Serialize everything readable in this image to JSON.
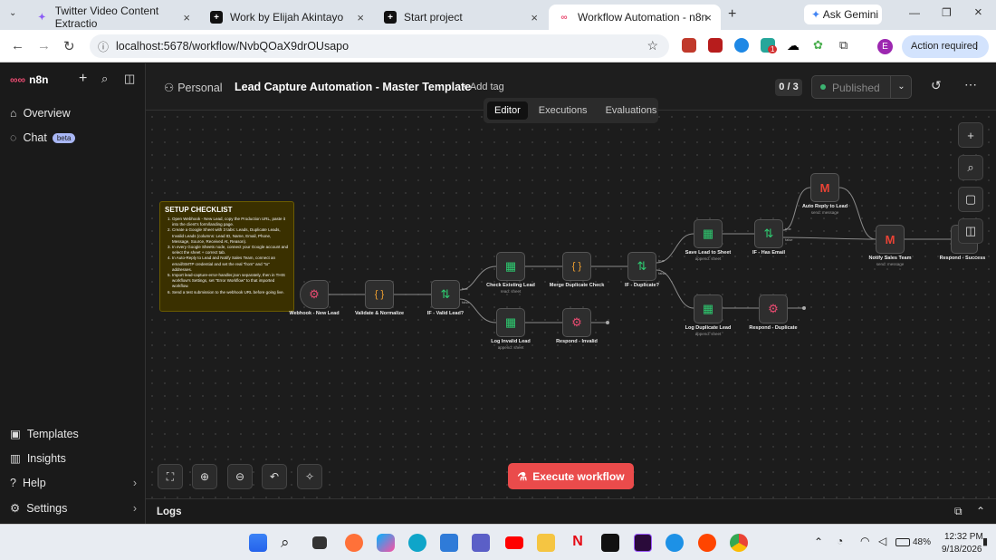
{
  "browser": {
    "tabs": [
      {
        "title": "Twitter Video Content Extractio",
        "icon_color": "#8b5cf6"
      },
      {
        "title": "Work by Elijah Akintayo",
        "icon_color": "#111111"
      },
      {
        "title": "Start project",
        "icon_color": "#111111"
      },
      {
        "title": "Workflow Automation - n8n",
        "icon_color": "#ea4b71"
      }
    ],
    "ask_gemini": "Ask Gemini",
    "url": "localhost:5678/workflow/NvbQOaX9drOUsapo",
    "action_required": "Action required",
    "profile_initial": "E",
    "ext_badge": "1"
  },
  "sidebar": {
    "logo": "n8n",
    "top_items": [
      {
        "label": "Overview",
        "icon": "home-icon"
      },
      {
        "label": "Chat",
        "icon": "chat-icon",
        "badge": "beta"
      }
    ],
    "bottom_items": [
      {
        "label": "Templates",
        "icon": "templates-icon"
      },
      {
        "label": "Insights",
        "icon": "insights-icon"
      },
      {
        "label": "Help",
        "icon": "help-icon"
      },
      {
        "label": "Settings",
        "icon": "settings-icon"
      }
    ]
  },
  "header": {
    "project": "Personal",
    "workflow_title": "Lead Capture Automation - Master Template",
    "add_tag": "+ Add tag",
    "counter": "0 / 3",
    "published": "Published"
  },
  "view_tabs": [
    "Editor",
    "Executions",
    "Evaluations"
  ],
  "note": {
    "title": "SETUP CHECKLIST",
    "items": [
      "Open Webhook - New Lead, copy the Production URL, paste it into the client's form/landing page.",
      "Create a Google Sheet with 3 tabs: Leads, Duplicate Leads, Invalid Leads (columns: Lead ID, Name, Email, Phone, Message, Source, Received At, Reason).",
      "In every Google Sheets node, connect your Google account and select the sheet + correct tab.",
      "In Auto-Reply to Lead and Notify Sales Team, connect an email/SMTP credential and set the real \"from\" and \"to\" addresses.",
      "Import lead-capture-error-handler.json separately, then in THIS workflow's Settings, set \"Error Workflow\" to that imported workflow.",
      "Send a test submission to the webhook URL before going live."
    ]
  },
  "nodes": [
    {
      "label": "Webhook - New Lead",
      "sub": "",
      "glyph": "⚙",
      "color": "#ea4b71"
    },
    {
      "label": "Validate & Normalize",
      "sub": "",
      "glyph": "{ }",
      "color": "#f0a030"
    },
    {
      "label": "IF - Valid Lead?",
      "sub": "",
      "glyph": "⇅",
      "color": "#2ecc71"
    },
    {
      "label": "Check Existing Lead",
      "sub": "read: sheet",
      "glyph": "▦",
      "color": "#2ecc71"
    },
    {
      "label": "Merge Duplicate Check",
      "sub": "",
      "glyph": "{ }",
      "color": "#f0a030"
    },
    {
      "label": "IF - Duplicate?",
      "sub": "",
      "glyph": "⇅",
      "color": "#2ecc71"
    },
    {
      "label": "Log Invalid Lead",
      "sub": "append: sheet",
      "glyph": "▦",
      "color": "#2ecc71"
    },
    {
      "label": "Respond - Invalid",
      "sub": "",
      "glyph": "⚙",
      "color": "#ea4b71"
    },
    {
      "label": "Save Lead to Sheet",
      "sub": "append: sheet",
      "glyph": "▦",
      "color": "#2ecc71"
    },
    {
      "label": "IF - Has Email",
      "sub": "",
      "glyph": "⇅",
      "color": "#2ecc71"
    },
    {
      "label": "Auto Reply to Lead",
      "sub": "send: message",
      "glyph": "M",
      "color": "#ea4335"
    },
    {
      "label": "Notify Sales Team",
      "sub": "send: message",
      "glyph": "M",
      "color": "#ea4335"
    },
    {
      "label": "Respond - Success",
      "sub": "",
      "glyph": "⚙",
      "color": "#ea4b71"
    },
    {
      "label": "Log Duplicate Lead",
      "sub": "append: sheet",
      "glyph": "▦",
      "color": "#2ecc71"
    },
    {
      "label": "Respond - Duplicate",
      "sub": "",
      "glyph": "⚙",
      "color": "#ea4b71"
    }
  ],
  "branch_labels": {
    "true": "true",
    "false": "false"
  },
  "execute_button": "Execute workflow",
  "logs_label": "Logs",
  "taskbar": {
    "time": "12:32 PM",
    "date": "9/18/2026",
    "battery": "48%"
  }
}
